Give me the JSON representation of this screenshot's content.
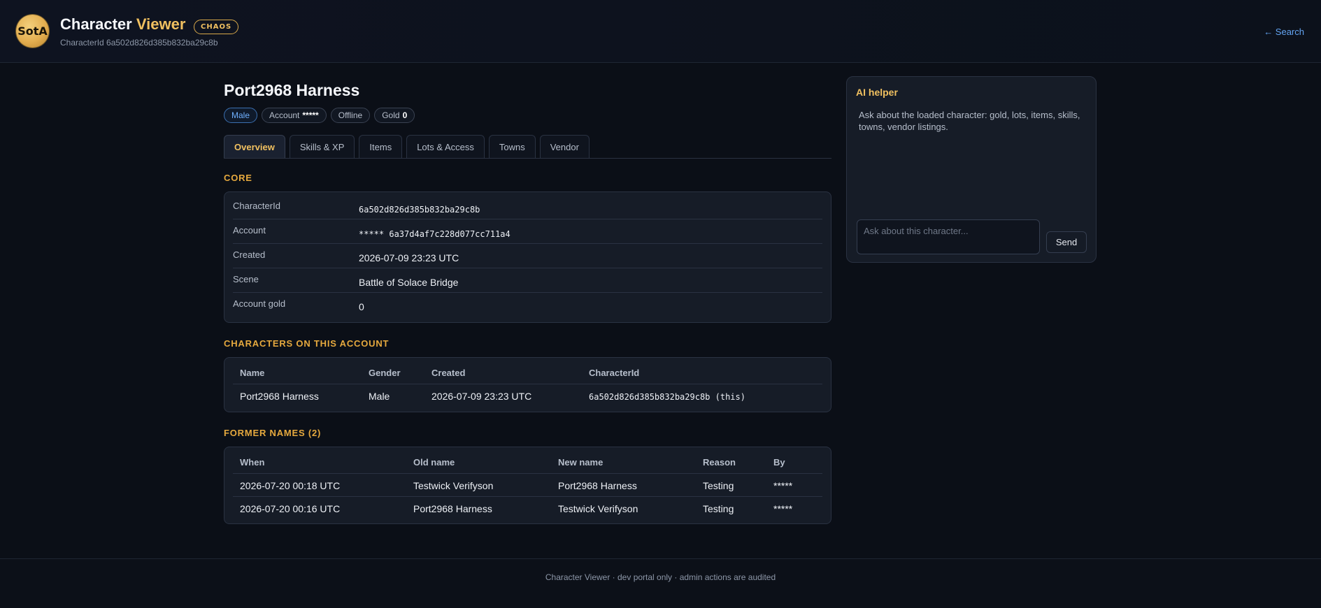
{
  "header": {
    "logo_text": "SotA",
    "title_main": "Character",
    "title_accent": "Viewer",
    "badge": "CHAOS",
    "subtitle": "CharacterId 6a502d826d385b832ba29c8b",
    "search_link": "← Search"
  },
  "character": {
    "name": "Port2968 Harness",
    "chips": {
      "gender": "Male",
      "account_label": "Account",
      "account_value": "*****",
      "status": "Offline",
      "gold_label": "Gold",
      "gold_value": "0"
    }
  },
  "tabs": [
    "Overview",
    "Skills & XP",
    "Items",
    "Lots & Access",
    "Towns",
    "Vendor"
  ],
  "core": {
    "title": "CORE",
    "rows": [
      {
        "key": "CharacterId",
        "value": "6a502d826d385b832ba29c8b"
      },
      {
        "key": "Account",
        "value": "***** 6a37d4af7c228d077cc711a4"
      },
      {
        "key": "Created",
        "value": "2026-07-09 23:23 UTC"
      },
      {
        "key": "Scene",
        "value": "Battle of Solace Bridge"
      },
      {
        "key": "Account gold",
        "value": "0"
      }
    ]
  },
  "characters": {
    "title": "CHARACTERS ON THIS ACCOUNT",
    "headers": [
      "Name",
      "Gender",
      "Created",
      "CharacterId"
    ],
    "rows": [
      [
        "Port2968 Harness",
        "Male",
        "2026-07-09 23:23 UTC",
        "6a502d826d385b832ba29c8b (this)"
      ]
    ]
  },
  "former_names": {
    "title": "FORMER NAMES (2)",
    "headers": [
      "When",
      "Old name",
      "New name",
      "Reason",
      "By"
    ],
    "rows": [
      [
        "2026-07-20 00:18 UTC",
        "Testwick Verifyson",
        "Port2968 Harness",
        "Testing",
        "*****"
      ],
      [
        "2026-07-20 00:16 UTC",
        "Port2968 Harness",
        "Testwick Verifyson",
        "Testing",
        "*****"
      ]
    ]
  },
  "ai_helper": {
    "title": "AI helper",
    "hint": "Ask about the loaded character: gold, lots, items, skills, towns, vendor listings.",
    "placeholder": "Ask about this character...",
    "send_label": "Send"
  },
  "footer": {
    "text": "Character Viewer · dev portal only · admin actions are audited"
  }
}
